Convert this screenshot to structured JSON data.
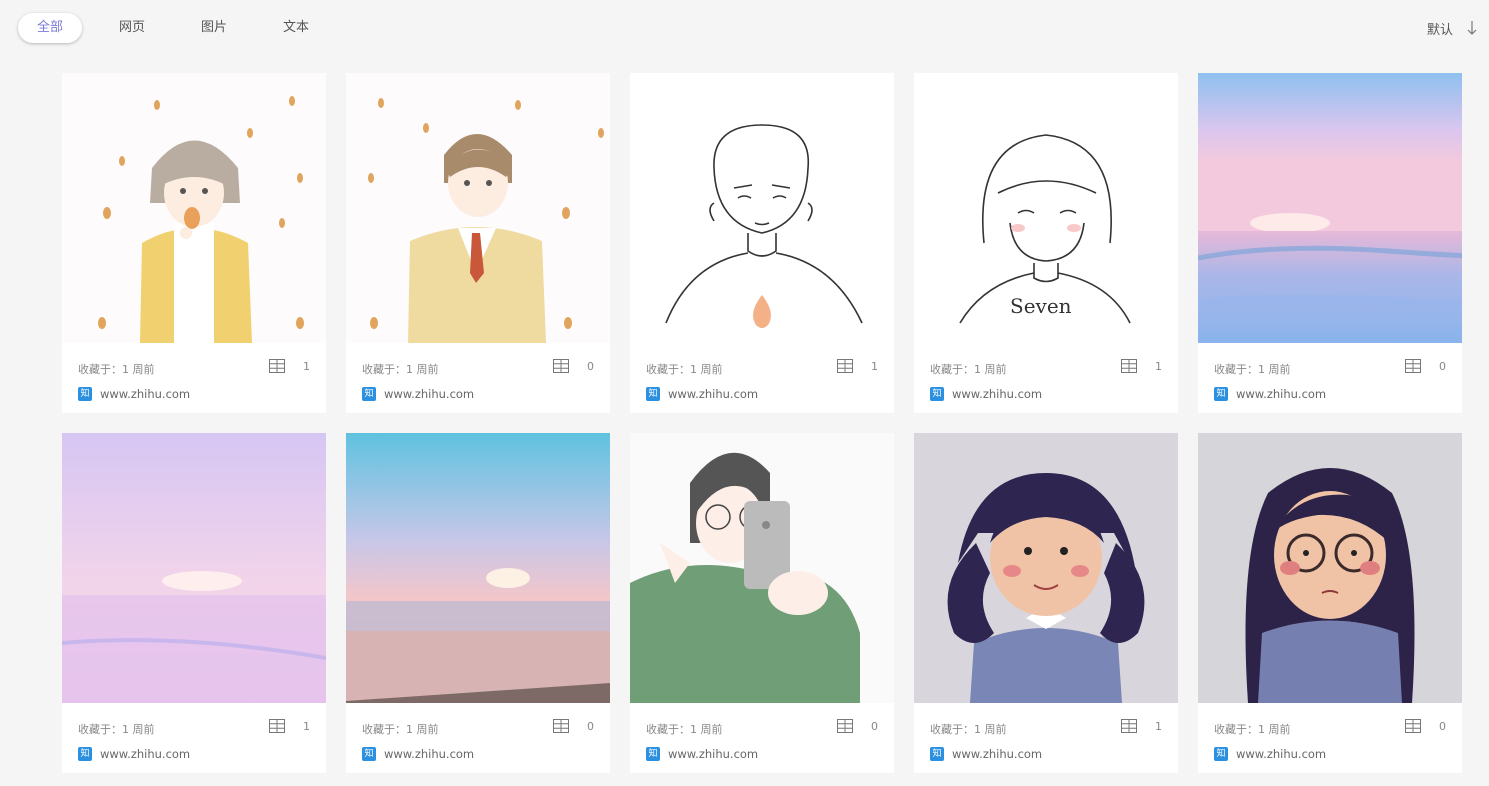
{
  "tabs": [
    {
      "label": "全部",
      "active": true
    },
    {
      "label": "网页",
      "active": false
    },
    {
      "label": "图片",
      "active": false
    },
    {
      "label": "文本",
      "active": false
    }
  ],
  "sort": {
    "label": "默认",
    "icon": "arrow-down-icon"
  },
  "cards": [
    {
      "saved": "收藏于：1 周前",
      "count": "1",
      "source": "www.zhihu.com",
      "source_icon": "知",
      "image": "illustrated girl in yellow cardigan with leaf"
    },
    {
      "saved": "收藏于：1 周前",
      "count": "0",
      "source": "www.zhihu.com",
      "source_icon": "知",
      "image": "illustrated boy in yellow blazer with tie"
    },
    {
      "saved": "收藏于：1 周前",
      "count": "1",
      "source": "www.zhihu.com",
      "source_icon": "知",
      "image": "line sketch of short-haired boy with flame"
    },
    {
      "saved": "收藏于：1 周前",
      "count": "1",
      "source": "www.zhihu.com",
      "source_icon": "知",
      "image": "line sketch of girl with bob and Seven shirt"
    },
    {
      "saved": "收藏于：1 周前",
      "count": "0",
      "source": "www.zhihu.com",
      "source_icon": "知",
      "image": "pastel pink ocean sunset"
    },
    {
      "saved": "收藏于：1 周前",
      "count": "1",
      "source": "www.zhihu.com",
      "source_icon": "知",
      "image": "lavender sea horizon"
    },
    {
      "saved": "收藏于：1 周前",
      "count": "0",
      "source": "www.zhihu.com",
      "source_icon": "知",
      "image": "pink beach sunset with blue sky"
    },
    {
      "saved": "收藏于：1 周前",
      "count": "0",
      "source": "www.zhihu.com",
      "source_icon": "知",
      "image": "girl in green sweater taking selfie"
    },
    {
      "saved": "收藏于：1 周前",
      "count": "1",
      "source": "www.zhihu.com",
      "source_icon": "知",
      "image": "cartoon girl with pigtails in blue sweater"
    },
    {
      "saved": "收藏于：1 周前",
      "count": "0",
      "source": "www.zhihu.com",
      "source_icon": "知",
      "image": "cartoon girl with glasses and long hair"
    }
  ]
}
